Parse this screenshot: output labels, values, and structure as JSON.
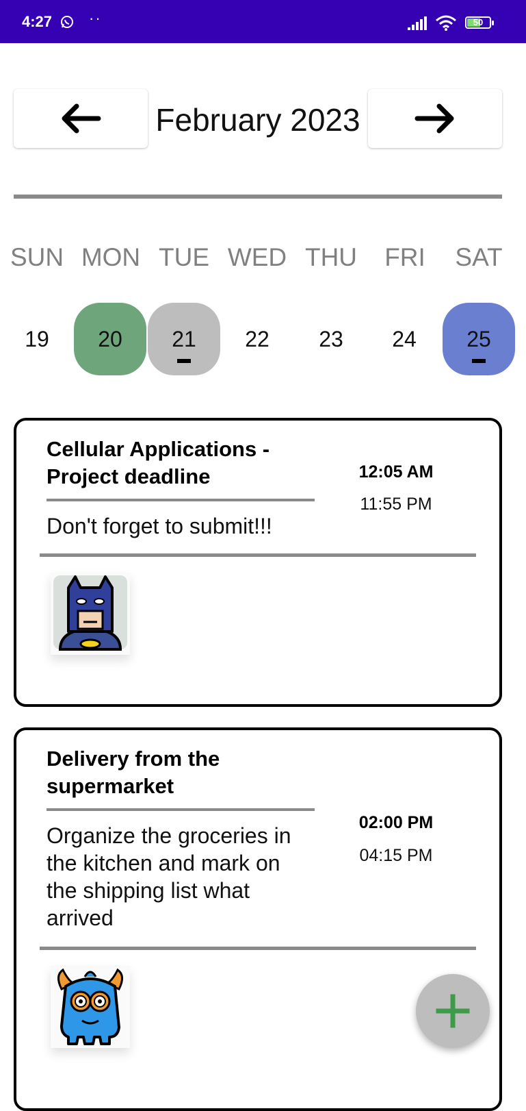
{
  "status_bar": {
    "time": "4:27",
    "dots": "··",
    "battery": "50",
    "icons": [
      "whatsapp-icon",
      "signal-icon",
      "wifi-icon",
      "battery-icon"
    ]
  },
  "header": {
    "month_label": "February 2023",
    "prev_icon": "arrow-left-icon",
    "next_icon": "arrow-right-icon"
  },
  "week": {
    "weekdays": [
      "SUN",
      "MON",
      "TUE",
      "WED",
      "THU",
      "FRI",
      "SAT"
    ],
    "days": [
      {
        "num": "19",
        "state": "normal"
      },
      {
        "num": "20",
        "state": "today",
        "color": "#6fa57a"
      },
      {
        "num": "21",
        "state": "has-event",
        "color": "#bdbdbd"
      },
      {
        "num": "22",
        "state": "normal"
      },
      {
        "num": "23",
        "state": "normal"
      },
      {
        "num": "24",
        "state": "normal"
      },
      {
        "num": "25",
        "state": "selected",
        "color": "#6b7fd1"
      }
    ]
  },
  "events": [
    {
      "title": "Cellular Applications - Project deadline",
      "description": "Don't forget to submit!!!",
      "start_time": "12:05 AM",
      "end_time": "11:55 PM",
      "avatar": "batman-avatar-icon"
    },
    {
      "title": "Delivery from the supermarket",
      "description": "Organize the groceries in the kitchen and mark on the shipping list what arrived",
      "start_time": "02:00 PM",
      "end_time": "04:15 PM",
      "avatar": "blue-monster-avatar-icon"
    }
  ],
  "fab": {
    "icon": "plus-icon",
    "color": "#3f9a4a"
  },
  "colors": {
    "status_bar": "#3600b3",
    "today": "#6fa57a",
    "event_day": "#bdbdbd",
    "selected_day": "#6b7fd1",
    "divider": "#8a8a8a"
  }
}
